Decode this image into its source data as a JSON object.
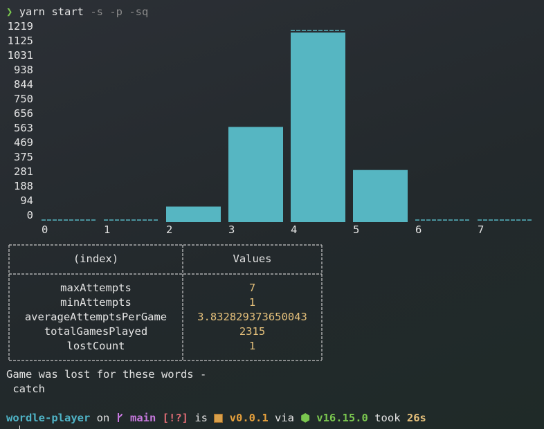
{
  "terminal": {
    "prompt_symbol": "❯",
    "command": "yarn start",
    "command_args": " -s -p -sq"
  },
  "chart_data": {
    "type": "bar",
    "categories": [
      "0",
      "1",
      "2",
      "3",
      "4",
      "5",
      "6",
      "7"
    ],
    "values": [
      0,
      0,
      100,
      612,
      1219,
      335,
      0,
      0
    ],
    "y_ticks": [
      "1219",
      "1125",
      "1031",
      "938",
      "844",
      "750",
      "656",
      "563",
      "469",
      "375",
      "281",
      "188",
      "94",
      "0"
    ],
    "ylim": [
      0,
      1219
    ],
    "bar_color": "#56b6c2",
    "grid": false
  },
  "table": {
    "columns": [
      "(index)",
      "Values"
    ],
    "rows": [
      {
        "key": "maxAttempts",
        "value": "7"
      },
      {
        "key": "minAttempts",
        "value": "1"
      },
      {
        "key": "averageAttemptsPerGame",
        "value": "3.832829373650043"
      },
      {
        "key": "totalGamesPlayed",
        "value": "2315"
      },
      {
        "key": "lostCount",
        "value": "1"
      }
    ],
    "value_color": "#e5c07b",
    "border_color": "#c8c8c8"
  },
  "output": {
    "lost_label": "Game was lost for these words -",
    "lost_words": [
      "catch"
    ]
  },
  "status": {
    "dir": "wordle-player",
    "on": " on ",
    "branch_icon": "git-branch-icon",
    "branch": "main",
    "git_status": "[!?]",
    "is": " is ",
    "package_icon": "package-icon",
    "package_version": "v0.0.1",
    "via": " via ",
    "node_icon": "node-icon",
    "node_version": "v16.15.0",
    "took": " took ",
    "duration": "26s"
  }
}
